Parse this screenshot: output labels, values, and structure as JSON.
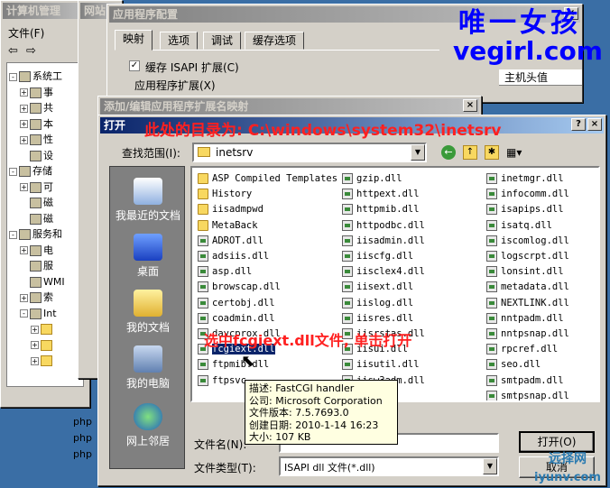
{
  "computer_mgmt": {
    "title": "计算机管理",
    "menu_file": "文件(F)",
    "tree": [
      {
        "label": "系统工",
        "level": 0,
        "exp": "-"
      },
      {
        "label": "事",
        "level": 1,
        "exp": "+"
      },
      {
        "label": "共",
        "level": 1,
        "exp": "+"
      },
      {
        "label": "本",
        "level": 1,
        "exp": "+"
      },
      {
        "label": "性",
        "level": 1,
        "exp": "+"
      },
      {
        "label": "设",
        "level": 1,
        "exp": ""
      },
      {
        "label": "存储",
        "level": 0,
        "exp": "-"
      },
      {
        "label": "可",
        "level": 1,
        "exp": "+"
      },
      {
        "label": "磁",
        "level": 1,
        "exp": ""
      },
      {
        "label": "磁",
        "level": 1,
        "exp": ""
      },
      {
        "label": "服务和",
        "level": 0,
        "exp": "-"
      },
      {
        "label": "电",
        "level": 1,
        "exp": "+"
      },
      {
        "label": "服",
        "level": 1,
        "exp": ""
      },
      {
        "label": "WMI",
        "level": 1,
        "exp": ""
      },
      {
        "label": "索",
        "level": 1,
        "exp": "+"
      },
      {
        "label": "Int",
        "level": 1,
        "exp": "-"
      },
      {
        "label": "",
        "level": 2,
        "exp": "+"
      },
      {
        "label": "",
        "level": 2,
        "exp": "+"
      },
      {
        "label": "",
        "level": 2,
        "exp": "+"
      }
    ],
    "php_items": [
      "php",
      "php",
      "php"
    ]
  },
  "web_window": {
    "title": "网站"
  },
  "app_config": {
    "title": "应用程序配置",
    "tabs": [
      "映射",
      "选项",
      "调试",
      "缓存选项"
    ],
    "cache_isapi": "缓存 ISAPI 扩展(C)",
    "app_ext_group": "应用程序扩展(X)",
    "right_col_header": "主机头值"
  },
  "add_edit": {
    "title": "添加/编辑应用程序扩展名映射"
  },
  "open_dialog": {
    "title": "打开",
    "lookin_label": "查找范围(I):",
    "lookin_value": "inetsrv",
    "places": [
      "我最近的文档",
      "桌面",
      "我的文档",
      "我的电脑",
      "网上邻居"
    ],
    "files_col1": [
      {
        "name": "ASP Compiled Templates",
        "kind": "folder"
      },
      {
        "name": "History",
        "kind": "folder"
      },
      {
        "name": "iisadmpwd",
        "kind": "folder"
      },
      {
        "name": "MetaBack",
        "kind": "folder"
      },
      {
        "name": "ADROT.dll",
        "kind": "dll"
      },
      {
        "name": "adsiis.dll",
        "kind": "dll"
      },
      {
        "name": "asp.dll",
        "kind": "dll"
      },
      {
        "name": "browscap.dll",
        "kind": "dll"
      },
      {
        "name": "certobj.dll",
        "kind": "dll"
      },
      {
        "name": "coadmin.dll",
        "kind": "dll"
      },
      {
        "name": "davcprox.dll",
        "kind": "dll"
      },
      {
        "name": "fcgiext.dll",
        "kind": "dll"
      },
      {
        "name": "ftpmib.dll",
        "kind": "dll"
      },
      {
        "name": "ftpsvc",
        "kind": "dll"
      }
    ],
    "files_col2": [
      {
        "name": "gzip.dll",
        "kind": "dll"
      },
      {
        "name": "httpext.dll",
        "kind": "dll"
      },
      {
        "name": "httpmib.dll",
        "kind": "dll"
      },
      {
        "name": "httpodbc.dll",
        "kind": "dll"
      },
      {
        "name": "iisadmin.dll",
        "kind": "dll"
      },
      {
        "name": "iiscfg.dll",
        "kind": "dll"
      },
      {
        "name": "iisclex4.dll",
        "kind": "dll"
      },
      {
        "name": "iisext.dll",
        "kind": "dll"
      },
      {
        "name": "iislog.dll",
        "kind": "dll"
      },
      {
        "name": "iisres.dll",
        "kind": "dll"
      },
      {
        "name": "iisrstas.dll",
        "kind": "dll"
      },
      {
        "name": "iisui.dll",
        "kind": "dll"
      },
      {
        "name": "iisutil.dll",
        "kind": "dll"
      },
      {
        "name": "iisw3adm.dll",
        "kind": "dll"
      }
    ],
    "files_col3": [
      {
        "name": "inetmgr.dll",
        "kind": "dll"
      },
      {
        "name": "infocomm.dll",
        "kind": "dll"
      },
      {
        "name": "isapips.dll",
        "kind": "dll"
      },
      {
        "name": "isatq.dll",
        "kind": "dll"
      },
      {
        "name": "iscomlog.dll",
        "kind": "dll"
      },
      {
        "name": "logscrpt.dll",
        "kind": "dll"
      },
      {
        "name": "lonsint.dll",
        "kind": "dll"
      },
      {
        "name": "metadata.dll",
        "kind": "dll"
      },
      {
        "name": "NEXTLINK.dll",
        "kind": "dll"
      },
      {
        "name": "nntpadm.dll",
        "kind": "dll"
      },
      {
        "name": "nntpsnap.dll",
        "kind": "dll"
      },
      {
        "name": "rpcref.dll",
        "kind": "dll"
      },
      {
        "name": "seo.dll",
        "kind": "dll"
      },
      {
        "name": "smtpadm.dll",
        "kind": "dll"
      },
      {
        "name": "smtpsnap.dll",
        "kind": "dll"
      }
    ],
    "tooltip": [
      "描述: FastCGI handler",
      "公司: Microsoft Corporation",
      "文件版本: 7.5.7693.0",
      "创建日期: 2010-1-14 16:23",
      "大小: 107 KB"
    ],
    "filename_label": "文件名(N):",
    "filename_value": "",
    "filetype_label": "文件类型(T):",
    "filetype_value": "ISAPI dll 文件(*.dll)",
    "open_button": "打开(O)",
    "cancel_button": "取消"
  },
  "annotations": {
    "dir_note": "此处的目录为: C:\\windows\\system32\\inetsrv",
    "select_note": "选中fcgiext.dll文件, 单击打开"
  },
  "watermark": {
    "brand_cn": "唯一女孩",
    "brand_url": "vegirl.com",
    "corner_cn": "远择网",
    "corner_url": "iyunv.com"
  },
  "colors": {
    "title_active": "#0a246a",
    "annotation": "#ff2020",
    "watermark": "#0000ff"
  }
}
